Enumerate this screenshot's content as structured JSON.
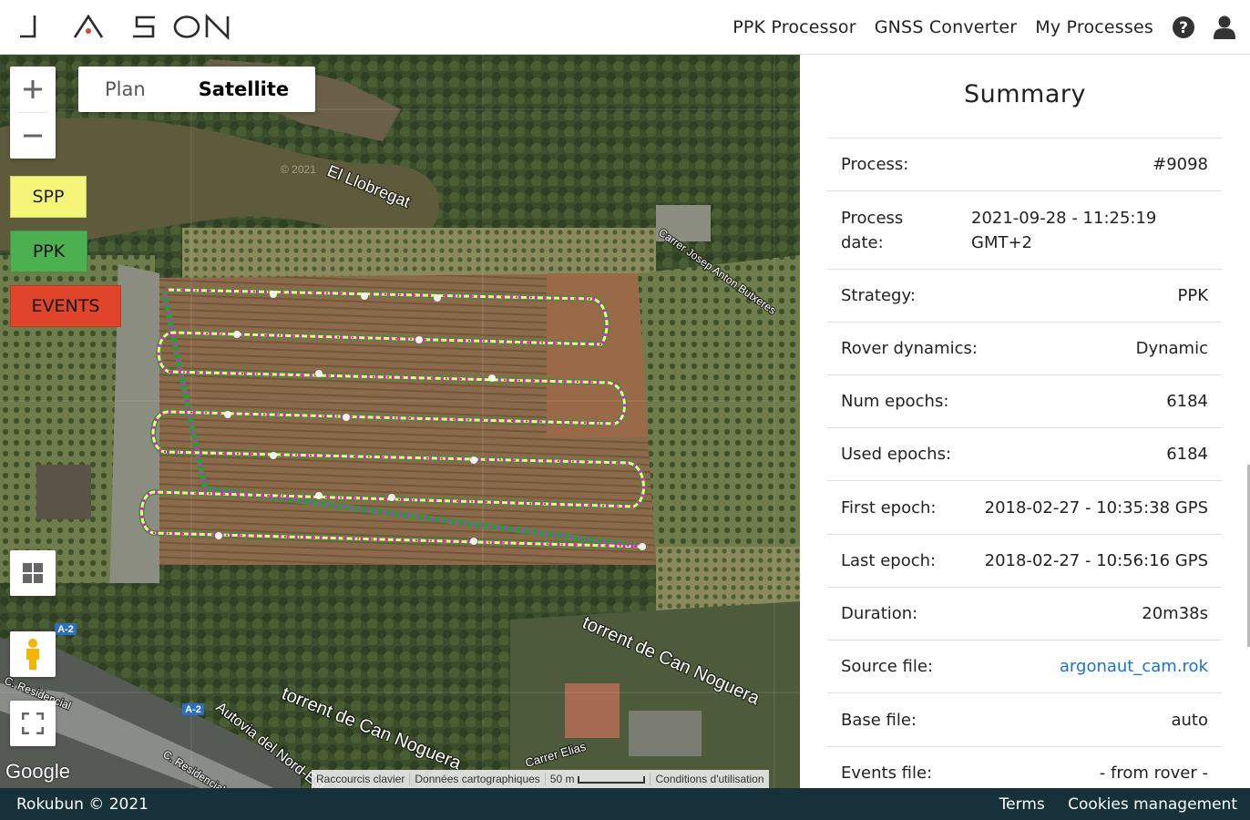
{
  "header": {
    "logo_text": "JASON",
    "nav": [
      "PPK Processor",
      "GNSS Converter",
      "My Processes"
    ],
    "help_icon": "question-circle-icon",
    "user_icon": "user-icon"
  },
  "map": {
    "map_types": [
      "Plan",
      "Satellite"
    ],
    "active_map_type": "Satellite",
    "layers": {
      "spp": "SPP",
      "ppk": "PPK",
      "events": "EVENTS"
    },
    "labels": {
      "river": "El Llobregat",
      "street1": "Carrer Josep Anton Butxeres",
      "torrent1": "torrent de Can Noguera",
      "torrent2": "torrent de Can Noguera",
      "autovia": "Autovia del Nord-Est",
      "street2": "Carrer Elias",
      "residencial1": "C. Residencial",
      "residencial2": "C. Residencial",
      "a2_1": "A-2",
      "a2_2": "A-2",
      "copyright": "© 2021"
    },
    "google": "Google",
    "attribution": {
      "shortcuts": "Raccourcis clavier",
      "data": "Données cartographiques",
      "scale": "50 m",
      "terms": "Conditions d'utilisation"
    },
    "colors": {
      "spp": "#f5f57a",
      "ppk": "#4caf50",
      "events": "#e0452c",
      "track": "#e020e0"
    }
  },
  "summary": {
    "title": "Summary",
    "rows": [
      {
        "k": "Process:",
        "v": "#9098"
      },
      {
        "k": "Process date:",
        "v": "2021-09-28 - 11:25:19 GMT+2"
      },
      {
        "k": "Strategy:",
        "v": "PPK"
      },
      {
        "k": "Rover dynamics:",
        "v": "Dynamic"
      },
      {
        "k": "Num epochs:",
        "v": "6184"
      },
      {
        "k": "Used epochs:",
        "v": "6184"
      },
      {
        "k": "First epoch:",
        "v": "2018-02-27 - 10:35:38 GPS"
      },
      {
        "k": "Last epoch:",
        "v": "2018-02-27 - 10:56:16 GPS"
      },
      {
        "k": "Duration:",
        "v": "20m38s"
      },
      {
        "k": "Source file:",
        "v": "argonaut_cam.rok"
      },
      {
        "k": "Base file:",
        "v": "auto"
      },
      {
        "k": "Events file:",
        "v": "- from rover -"
      }
    ]
  },
  "footer": {
    "copyright": "Rokubun © 2021",
    "links": [
      "Terms",
      "Cookies management"
    ]
  }
}
